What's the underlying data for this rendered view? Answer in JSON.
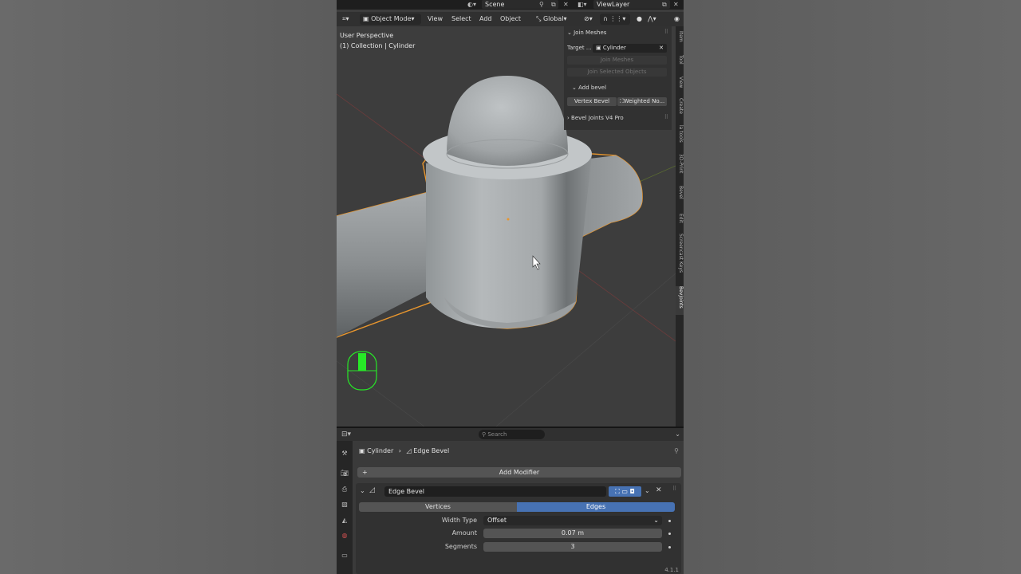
{
  "topbar": {
    "scene_label": "Scene",
    "viewlayer_label": "ViewLayer"
  },
  "header": {
    "mode": "Object Mode",
    "menus": [
      "View",
      "Select",
      "Add",
      "Object"
    ],
    "orientation": "Global"
  },
  "viewport": {
    "perspective": "User Perspective",
    "collection_info": "(1) Collection | Cylinder"
  },
  "npanel": {
    "join_title": "Join Meshes",
    "target_label": "Target ...",
    "target_value": "Cylinder",
    "join_meshes_btn": "Join Meshes",
    "join_selected_btn": "Join Selected Objects",
    "add_bevel_title": "Add bevel",
    "vertex_bevel_btn": "Vertex Bevel",
    "weighted_btn": "Weighted No...",
    "bevel_joints_title": "Bevel Joints V4 Pro"
  },
  "right_tabs": [
    "Item",
    "Tool",
    "View",
    "Create",
    "la tools",
    "3D-Print",
    "Bevel",
    "Edit",
    "Screencast Keys",
    "BevJoints"
  ],
  "properties": {
    "search_placeholder": "Search",
    "object_name": "Cylinder",
    "modifier_crumb": "Edge Bevel",
    "add_modifier": "Add Modifier",
    "modifier_name": "Edge Bevel",
    "affect_options": [
      "Vertices",
      "Edges"
    ],
    "affect_selected": "Edges",
    "width_type_label": "Width Type",
    "width_type_value": "Offset",
    "amount_label": "Amount",
    "amount_value": "0.07 m",
    "segments_label": "Segments",
    "segments_value": "3"
  },
  "version": "4.1.1",
  "colors": {
    "selection_outline": "#e8962e",
    "accent_blue": "#4772b3",
    "mouse_indicator": "#27e827",
    "axis_red": "#b03a3a",
    "axis_green": "#7a9a2a"
  }
}
